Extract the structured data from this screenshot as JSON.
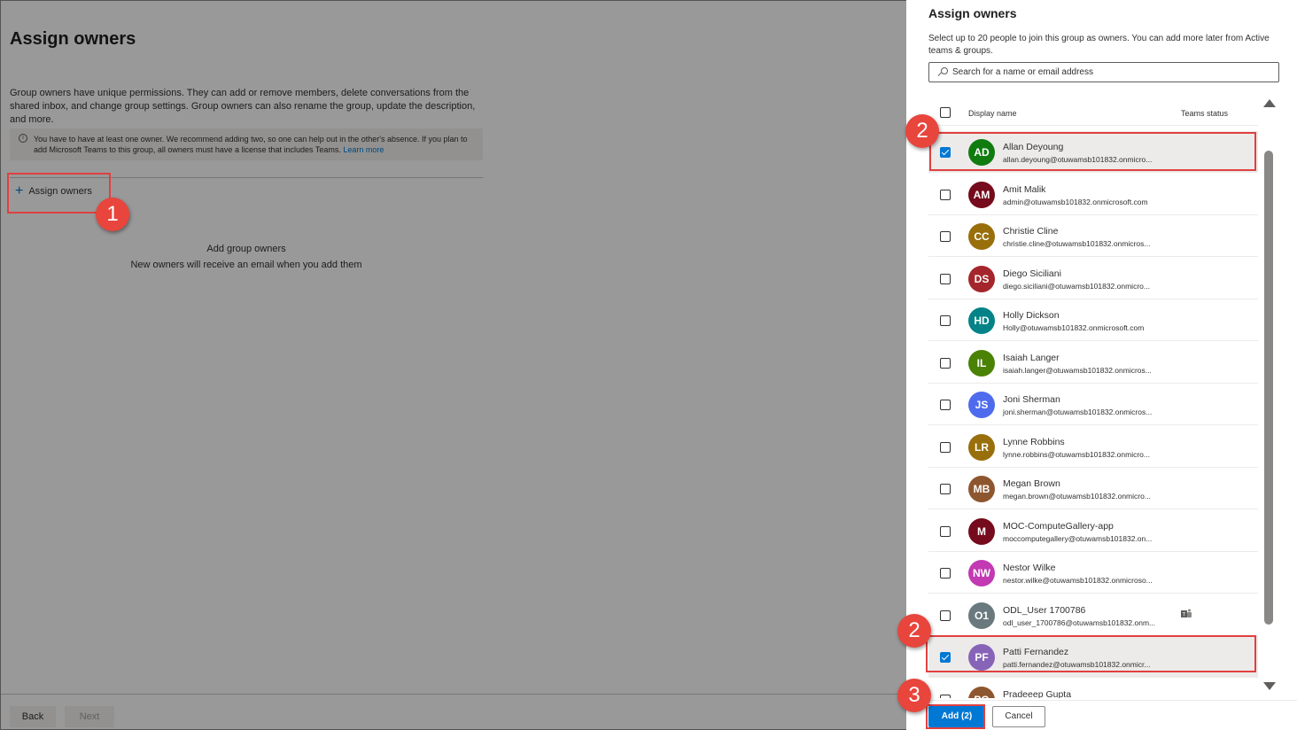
{
  "background_page": {
    "title": "Assign owners",
    "description": "Group owners have unique permissions. They can add or remove members, delete conversations from the shared inbox, and change group settings. Group owners can also rename the group, update the description, and more.",
    "info_text": "You have to have at least one owner. We recommend adding two, so one can help out in the other's absence. If you plan to add Microsoft Teams to this group, all owners must have a license that includes Teams.",
    "info_link": "Learn more",
    "assign_button": "Assign owners",
    "empty_title": "Add group owners",
    "empty_subtitle": "New owners will receive an email when you add them",
    "back_button": "Back",
    "next_button": "Next"
  },
  "panel": {
    "title": "Assign owners",
    "description": "Select up to 20 people to join this group as owners. You can add more later from Active teams & groups.",
    "search_placeholder": "Search for a name or email address",
    "col_display_name": "Display name",
    "col_teams_status": "Teams status",
    "add_button": "Add (2)",
    "cancel_button": "Cancel"
  },
  "users": [
    {
      "initials": "AD",
      "name": "Allan Deyoung",
      "email": "allan.deyoung@otuwamsb101832.onmicro...",
      "color": "#107c10",
      "checked": true
    },
    {
      "initials": "AM",
      "name": "Amit Malik",
      "email": "admin@otuwamsb101832.onmicrosoft.com",
      "color": "#750b1c",
      "checked": false
    },
    {
      "initials": "CC",
      "name": "Christie Cline",
      "email": "christie.cline@otuwamsb101832.onmicros...",
      "color": "#986f0b",
      "checked": false
    },
    {
      "initials": "DS",
      "name": "Diego Siciliani",
      "email": "diego.siciliani@otuwamsb101832.onmicro...",
      "color": "#a4262c",
      "checked": false
    },
    {
      "initials": "HD",
      "name": "Holly Dickson",
      "email": "Holly@otuwamsb101832.onmicrosoft.com",
      "color": "#038387",
      "checked": false
    },
    {
      "initials": "IL",
      "name": "Isaiah Langer",
      "email": "isaiah.langer@otuwamsb101832.onmicros...",
      "color": "#498205",
      "checked": false
    },
    {
      "initials": "JS",
      "name": "Joni Sherman",
      "email": "joni.sherman@otuwamsb101832.onmicros...",
      "color": "#4f6bed",
      "checked": false
    },
    {
      "initials": "LR",
      "name": "Lynne Robbins",
      "email": "lynne.robbins@otuwamsb101832.onmicro...",
      "color": "#986f0b",
      "checked": false
    },
    {
      "initials": "MB",
      "name": "Megan Brown",
      "email": "megan.brown@otuwamsb101832.onmicro...",
      "color": "#8e562e",
      "checked": false
    },
    {
      "initials": "M",
      "name": "MOC-ComputeGallery-app",
      "email": "moccomputegallery@otuwamsb101832.on...",
      "color": "#750b1c",
      "checked": false
    },
    {
      "initials": "NW",
      "name": "Nestor Wilke",
      "email": "nestor.wilke@otuwamsb101832.onmicroso...",
      "color": "#c239b3",
      "checked": false
    },
    {
      "initials": "O1",
      "name": "ODL_User 1700786",
      "email": "odl_user_1700786@otuwamsb101832.onm...",
      "color": "#69797e",
      "checked": false,
      "teams_icon": "teams-icon"
    },
    {
      "initials": "PF",
      "name": "Patti Fernandez",
      "email": "patti.fernandez@otuwamsb101832.onmicr...",
      "color": "#8764b8",
      "checked": true
    },
    {
      "initials": "PG",
      "name": "Pradeeep Gupta",
      "email": "",
      "color": "#8e562e",
      "checked": false
    }
  ],
  "annotations": [
    "1",
    "2",
    "2",
    "3"
  ],
  "colors": {
    "accent": "#0078d4",
    "annotation": "#e8453c"
  }
}
